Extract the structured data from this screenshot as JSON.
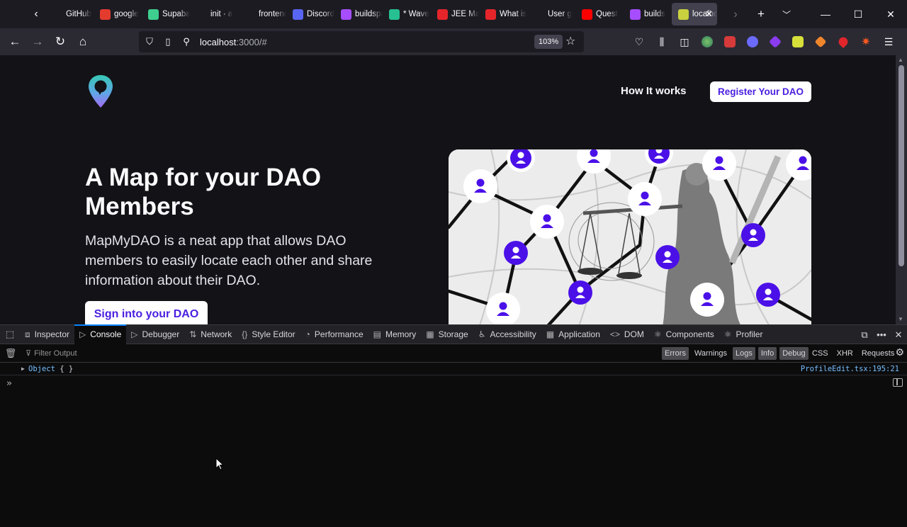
{
  "browser": {
    "tabs": [
      {
        "label": "GitHub",
        "icon": "github-icon",
        "color": "#1c1b22"
      },
      {
        "label": "google",
        "icon": "google-icon",
        "color": "#e33b2e"
      },
      {
        "label": "Supabase",
        "icon": "supabase-icon",
        "color": "#3ecf8e"
      },
      {
        "label": "init · a",
        "icon": "github-icon",
        "color": "#1c1b22"
      },
      {
        "label": "frontend",
        "icon": "github-icon",
        "color": "#1c1b22"
      },
      {
        "label": "Discord",
        "icon": "discord-icon",
        "color": "#5865f2"
      },
      {
        "label": "buildspace",
        "icon": "buildspace-icon",
        "color": "#a64dff"
      },
      {
        "label": "* Wave",
        "icon": "wave-icon",
        "color": "#27c093"
      },
      {
        "label": "JEE Main",
        "icon": "jee-icon",
        "color": "#e5252a"
      },
      {
        "label": "What is",
        "icon": "jee-icon",
        "color": "#e5252a"
      },
      {
        "label": "User g",
        "icon": "github-icon",
        "color": "#1c1b22"
      },
      {
        "label": "Quest",
        "icon": "youtube-icon",
        "color": "#ff0000"
      },
      {
        "label": "builds",
        "icon": "buildspace-icon",
        "color": "#a64dff"
      },
      {
        "label": "localhost",
        "icon": "localhost-icon",
        "color": "#c9d13f",
        "active": true
      }
    ],
    "url_host": "localhost",
    "url_rest": ":3000/#",
    "zoom": "103%"
  },
  "page": {
    "nav_link": "How It works",
    "register_button": "Register Your DAO",
    "hero_title": "A Map for your DAO Members",
    "hero_description": "MapMyDAO is a neat app that allows DAO members to easily locate each other and share information about their DAO.",
    "signin_button": "Sign into your DAO",
    "accent_color": "#4b1fe0"
  },
  "devtools": {
    "tabs": [
      {
        "label": "Inspector",
        "icon": "inspector-icon",
        "glyph": "⧈"
      },
      {
        "label": "Console",
        "icon": "console-icon",
        "glyph": "▷",
        "active": true
      },
      {
        "label": "Debugger",
        "icon": "debugger-icon",
        "glyph": "▷"
      },
      {
        "label": "Network",
        "icon": "network-icon",
        "glyph": "⇅"
      },
      {
        "label": "Style Editor",
        "icon": "style-editor-icon",
        "glyph": "{}"
      },
      {
        "label": "Performance",
        "icon": "performance-icon",
        "glyph": "◔"
      },
      {
        "label": "Memory",
        "icon": "memory-icon",
        "glyph": "▤"
      },
      {
        "label": "Storage",
        "icon": "storage-icon",
        "glyph": "▦"
      },
      {
        "label": "Accessibility",
        "icon": "accessibility-icon",
        "glyph": "♿"
      },
      {
        "label": "Application",
        "icon": "application-icon",
        "glyph": "▦"
      },
      {
        "label": "DOM",
        "icon": "dom-icon",
        "glyph": "<>"
      },
      {
        "label": "Components",
        "icon": "react-icon",
        "glyph": "⚛"
      },
      {
        "label": "Profiler",
        "icon": "react-icon",
        "glyph": "⚛"
      }
    ],
    "filter_placeholder": "Filter Output",
    "levels": [
      {
        "label": "Errors",
        "on": true
      },
      {
        "label": "Warnings",
        "on": false
      },
      {
        "label": "Logs",
        "on": true
      },
      {
        "label": "Info",
        "on": true
      },
      {
        "label": "Debug",
        "on": true
      }
    ],
    "request_filters": [
      "CSS",
      "XHR",
      "Requests"
    ],
    "log_entry": {
      "object_label": "Object",
      "braces": "{  }",
      "source": "ProfileEdit.tsx:195:21"
    }
  }
}
